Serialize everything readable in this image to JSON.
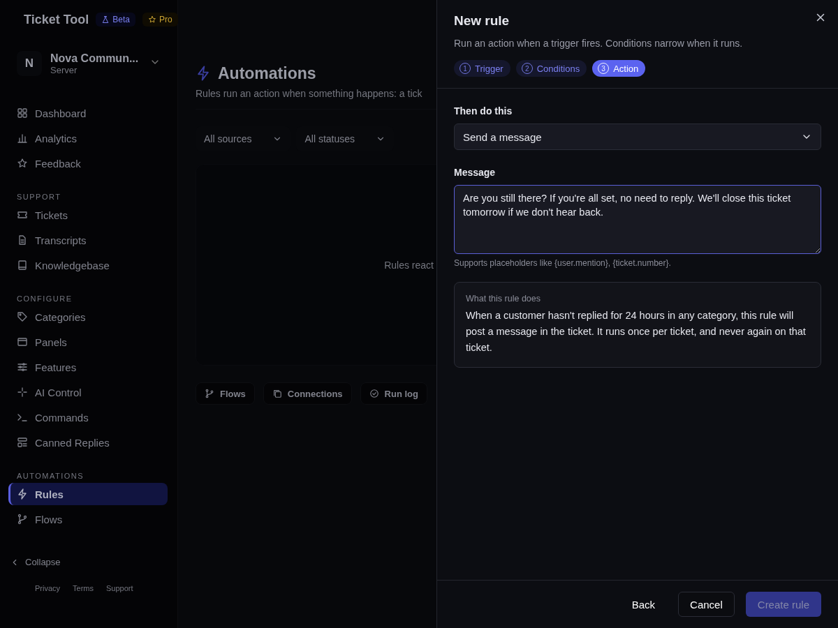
{
  "app": {
    "name": "Ticket Tool",
    "badges": [
      {
        "kind": "beta",
        "label": "Beta"
      },
      {
        "kind": "pro",
        "label": "Pro"
      }
    ]
  },
  "server": {
    "avatar": "N",
    "name": "Nova Commun...",
    "subtitle": "Server"
  },
  "sidebar": {
    "sections": [
      {
        "items": [
          {
            "label": "Dashboard",
            "selected": false
          },
          {
            "label": "Analytics",
            "selected": false
          },
          {
            "label": "Feedback",
            "selected": false
          }
        ]
      },
      {
        "heading": "SUPPORT",
        "items": [
          {
            "label": "Tickets",
            "selected": false
          },
          {
            "label": "Transcripts",
            "selected": false
          },
          {
            "label": "Knowledgebase",
            "selected": false
          }
        ]
      },
      {
        "heading": "CONFIGURE",
        "items": [
          {
            "label": "Categories",
            "selected": false
          },
          {
            "label": "Panels",
            "selected": false
          },
          {
            "label": "Features",
            "selected": false
          },
          {
            "label": "AI Control",
            "selected": false
          },
          {
            "label": "Commands",
            "selected": false
          },
          {
            "label": "Canned Replies",
            "selected": false
          }
        ]
      },
      {
        "heading": "AUTOMATIONS",
        "items": [
          {
            "label": "Rules",
            "selected": true
          },
          {
            "label": "Flows",
            "selected": false
          }
        ]
      }
    ],
    "collapse": "Collapse",
    "footer_links": [
      "Privacy",
      "Terms",
      "Support"
    ]
  },
  "main": {
    "title": "Automations",
    "subtitle": "Rules run an action when something happens: a tick",
    "filters": [
      "All sources",
      "All statuses"
    ],
    "empty_text": "Rules react",
    "tabs": [
      "Flows",
      "Connections",
      "Run log"
    ]
  },
  "drawer": {
    "title": "New rule",
    "subtitle": "Run an action when a trigger fires. Conditions narrow when it runs.",
    "steps": [
      {
        "number": "1",
        "label": "Trigger",
        "selected": false
      },
      {
        "number": "2",
        "label": "Conditions",
        "selected": false
      },
      {
        "number": "3",
        "label": "Action",
        "selected": true
      }
    ],
    "action_label": "Then do this",
    "action_value": "Send a message",
    "message_label": "Message",
    "message_value": "Are you still there? If you're all set, no need to reply. We'll close this ticket tomorrow if we don't hear back.",
    "hint": "Supports placeholders like {user.mention}, {ticket.number}.",
    "summary": {
      "title": "What this rule does",
      "text": "When a customer hasn't replied for 24 hours in any category, this rule will post a message in the ticket. It runs once per ticket, and never again on that ticket."
    },
    "buttons": [
      {
        "label": "Back",
        "kind": "ghost",
        "disabled": false
      },
      {
        "label": "Cancel",
        "kind": "outline",
        "disabled": false
      },
      {
        "label": "Create rule",
        "kind": "primary",
        "disabled": true
      }
    ]
  }
}
